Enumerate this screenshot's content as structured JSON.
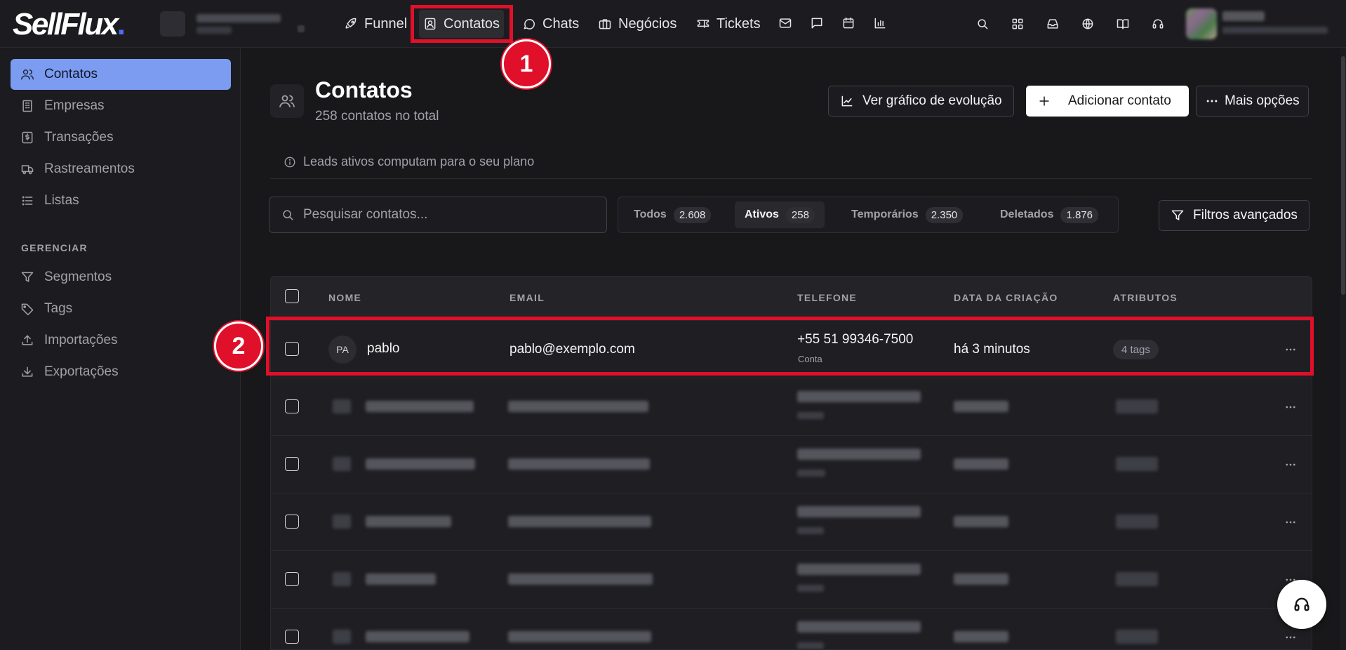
{
  "app": {
    "logo_text": "SellFlux",
    "logo_dot": "."
  },
  "topnav": {
    "items": [
      {
        "label": "Funnel"
      },
      {
        "label": "Contatos"
      },
      {
        "label": "Chats"
      },
      {
        "label": "Negócios"
      },
      {
        "label": "Tickets"
      }
    ]
  },
  "sidebar": {
    "items": [
      {
        "label": "Contatos"
      },
      {
        "label": "Empresas"
      },
      {
        "label": "Transações"
      },
      {
        "label": "Rastreamentos"
      },
      {
        "label": "Listas"
      }
    ],
    "section_label": "GERENCIAR",
    "manage_items": [
      {
        "label": "Segmentos"
      },
      {
        "label": "Tags"
      },
      {
        "label": "Importações"
      },
      {
        "label": "Exportações"
      }
    ]
  },
  "page": {
    "title": "Contatos",
    "subtitle": "258 contatos no total",
    "btn_chart": "Ver gráfico de evolução",
    "btn_add": "Adicionar contato",
    "btn_more": "Mais opções",
    "info": "Leads ativos computam para o seu plano"
  },
  "search": {
    "placeholder": "Pesquisar contatos..."
  },
  "filters": {
    "tabs": [
      {
        "label": "Todos",
        "count": "2.608"
      },
      {
        "label": "Ativos",
        "count": "258"
      },
      {
        "label": "Temporários",
        "count": "2.350"
      },
      {
        "label": "Deletados",
        "count": "1.876"
      }
    ],
    "active": "Ativos",
    "advanced": "Filtros avançados"
  },
  "table": {
    "columns": [
      "NOME",
      "EMAIL",
      "TELEFONE",
      "DATA DA CRIAÇÃO",
      "ATRIBUTOS"
    ],
    "rows": [
      {
        "initials": "PA",
        "name": "pablo",
        "email": "pablo@exemplo.com",
        "phone": "+55 51 99346-7500",
        "phone_type": "Conta",
        "created": "há 3 minutos",
        "tags": "4 tags"
      }
    ]
  },
  "annotations": {
    "step1": "1",
    "step2": "2"
  },
  "colors": {
    "highlight": "#e0102a",
    "active_sidebar": "#7b9cf0",
    "background": "#18181b"
  }
}
